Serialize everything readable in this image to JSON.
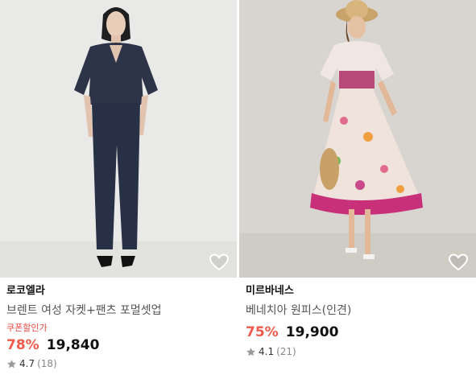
{
  "products": [
    {
      "brand": "로코엘라",
      "name": "브렌트 여성 자켓+팬츠 포멀셋업",
      "coupon_label": "쿠폰할인가",
      "discount": "78%",
      "price": "19,840",
      "rating": "4.7",
      "reviews": "(18)",
      "image_icon": "model-navy-set",
      "wishlist_icon": "heart-icon"
    },
    {
      "brand": "미르바네스",
      "name": "베네치아 원피스(인견)",
      "coupon_label": "",
      "discount": "75%",
      "price": "19,900",
      "rating": "4.1",
      "reviews": "(21)",
      "image_icon": "model-floral-dress",
      "wishlist_icon": "heart-icon"
    }
  ],
  "colors": {
    "discount": "#ef5a4c",
    "coupon": "#e8463f",
    "star": "#9a9a9a"
  }
}
